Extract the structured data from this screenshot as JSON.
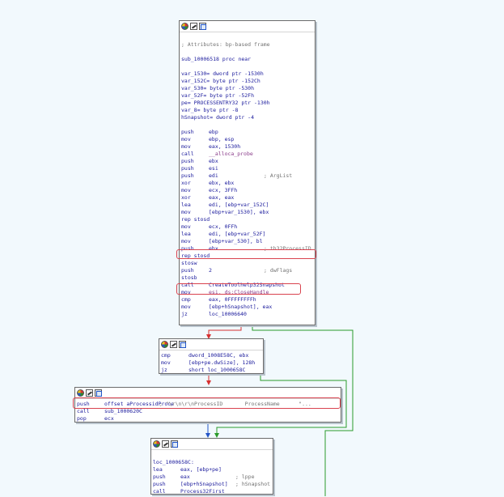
{
  "colors": {
    "background": "#f2f9fd",
    "edge_true": "#2a9a2a",
    "edge_false": "#d73131",
    "edge_uncond": "#2456c8",
    "highlight": "#d9434f"
  },
  "toolbar_icons": [
    "color-icon",
    "pencil-icon",
    "graph-icon"
  ],
  "block1": {
    "lines": [
      {
        "kind": "blank"
      },
      {
        "kind": "comment",
        "text": "; Attributes: bp-based frame"
      },
      {
        "kind": "blank"
      },
      {
        "kind": "label",
        "text": "sub_10006518 proc near"
      },
      {
        "kind": "blank"
      },
      {
        "kind": "label",
        "text": "var_1530= dword ptr -1530h"
      },
      {
        "kind": "label",
        "text": "var_152C= byte ptr -152Ch"
      },
      {
        "kind": "label",
        "text": "var_530= byte ptr -530h"
      },
      {
        "kind": "label",
        "text": "var_52F= byte ptr -52Fh"
      },
      {
        "kind": "label",
        "text": "pe= PROCESSENTRY32 ptr -130h"
      },
      {
        "kind": "label",
        "text": "var_8= byte ptr -8"
      },
      {
        "kind": "label",
        "text": "hSnapshot= dword ptr -4"
      },
      {
        "kind": "blank"
      },
      {
        "kind": "ins",
        "m": "push",
        "o": "ebp",
        "c": ""
      },
      {
        "kind": "ins",
        "m": "mov",
        "o": "ebp, esp",
        "c": ""
      },
      {
        "kind": "ins",
        "m": "mov",
        "o": "eax, 1530h",
        "c": ""
      },
      {
        "kind": "ins",
        "m": "call",
        "o": "__alloca_probe",
        "c": "",
        "ref": true
      },
      {
        "kind": "ins",
        "m": "push",
        "o": "ebx",
        "c": ""
      },
      {
        "kind": "ins",
        "m": "push",
        "o": "esi",
        "c": ""
      },
      {
        "kind": "ins",
        "m": "push",
        "o": "edi",
        "c": "; ArgList"
      },
      {
        "kind": "ins",
        "m": "xor",
        "o": "ebx, ebx",
        "c": ""
      },
      {
        "kind": "ins",
        "m": "mov",
        "o": "ecx, 3FFh",
        "c": ""
      },
      {
        "kind": "ins",
        "m": "xor",
        "o": "eax, eax",
        "c": ""
      },
      {
        "kind": "ins",
        "m": "lea",
        "o": "edi, [ebp+var_152C]",
        "c": ""
      },
      {
        "kind": "ins",
        "m": "mov",
        "o": "[ebp+var_1530], ebx",
        "c": ""
      },
      {
        "kind": "ins",
        "m": "rep stosd",
        "o": "",
        "c": ""
      },
      {
        "kind": "ins",
        "m": "mov",
        "o": "ecx, 0FFh",
        "c": ""
      },
      {
        "kind": "ins",
        "m": "lea",
        "o": "edi, [ebp+var_52F]",
        "c": ""
      },
      {
        "kind": "ins",
        "m": "mov",
        "o": "[ebp+var_530], bl",
        "c": ""
      },
      {
        "kind": "ins",
        "m": "push",
        "o": "ebx",
        "c": "; th32ProcessID"
      },
      {
        "kind": "ins",
        "m": "rep stosd",
        "o": "",
        "c": ""
      },
      {
        "kind": "ins",
        "m": "stosw",
        "o": "",
        "c": ""
      },
      {
        "kind": "ins",
        "m": "push",
        "o": "2",
        "c": "; dwFlags"
      },
      {
        "kind": "ins",
        "m": "stosb",
        "o": "",
        "c": ""
      },
      {
        "kind": "ins",
        "m": "call",
        "o": "CreateToolhelp32Snapshot",
        "c": ""
      },
      {
        "kind": "ins",
        "m": "mov",
        "o": "esi, ds:CloseHandle",
        "c": "",
        "ref2": true
      },
      {
        "kind": "ins",
        "m": "cmp",
        "o": "eax, 0FFFFFFFFh",
        "c": ""
      },
      {
        "kind": "ins",
        "m": "mov",
        "o": "[ebp+hSnapshot], eax",
        "c": ""
      },
      {
        "kind": "ins",
        "m": "jz",
        "o": "loc_10006640",
        "c": ""
      }
    ]
  },
  "block2": {
    "lines": [
      {
        "kind": "ins",
        "m": "cmp",
        "o": "dword_1008E58C, ebx",
        "c": ""
      },
      {
        "kind": "ins",
        "m": "mov",
        "o": "[ebp+pe.dwSize], 128h",
        "c": ""
      },
      {
        "kind": "ins",
        "m": "jz",
        "o": "short loc_1000658C",
        "c": ""
      }
    ]
  },
  "block3": {
    "lines": [
      {
        "kind": "ins",
        "m": "push",
        "o": "offset aProcessidProce",
        "c": "; \"\\r\\n\\r\\nProcessID       ProcessName      \"..."
      },
      {
        "kind": "ins",
        "m": "call",
        "o": "sub_1000620C",
        "c": ""
      },
      {
        "kind": "ins",
        "m": "pop",
        "o": "ecx",
        "c": ""
      }
    ]
  },
  "block4": {
    "lines": [
      {
        "kind": "blank"
      },
      {
        "kind": "label",
        "text": "loc_1000658C:"
      },
      {
        "kind": "ins",
        "m": "lea",
        "o": "eax, [ebp+pe]",
        "c": ""
      },
      {
        "kind": "ins",
        "m": "push",
        "o": "eax",
        "c": "; lppe"
      },
      {
        "kind": "ins",
        "m": "push",
        "o": "[ebp+hSnapshot]",
        "c": "; hSnapshot"
      },
      {
        "kind": "ins",
        "m": "call",
        "o": "Process32First",
        "c": ""
      }
    ]
  }
}
